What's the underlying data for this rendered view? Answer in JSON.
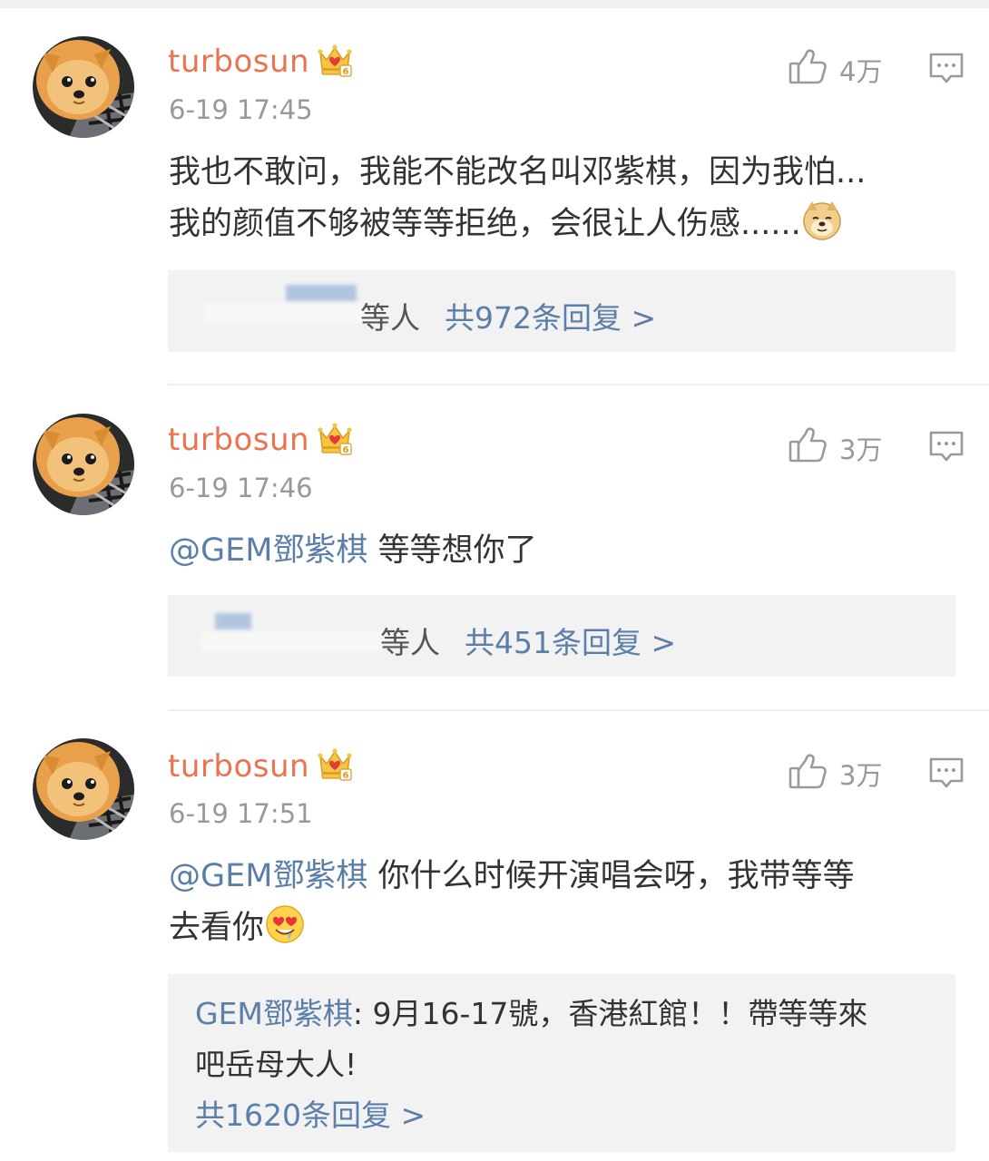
{
  "comments": [
    {
      "username": "turbosun",
      "time": "6-19 17:45",
      "likes": "4万",
      "text_line1": "我也不敢问，我能不能改名叫邓紫棋，因为我怕...",
      "text_line2": "我的颜值不够被等等拒绝，会很让人伤感......",
      "reply_suffix": "等人",
      "reply_total": "共972条回复 >"
    },
    {
      "username": "turbosun",
      "time": "6-19 17:46",
      "likes": "3万",
      "mention": "@GEM鄧紫棋",
      "text": " 等等想你了",
      "reply_suffix": "等人",
      "reply_total": "共451条回复 >"
    },
    {
      "username": "turbosun",
      "time": "6-19 17:51",
      "likes": "3万",
      "mention": "@GEM鄧紫棋",
      "text_line1": " 你什么时候开演唱会呀，我带等等",
      "text_line2": "去看你",
      "reply_name": "GEM鄧紫棋",
      "reply_text_line1": ": 9月16-17號，香港紅館！！帶等等來",
      "reply_text_line2": "吧岳母大人!",
      "reply_total": "共1620条回复 >"
    }
  ],
  "icons": {
    "avatar": "pomeranian-avatar-icon",
    "badge": "crown-badge-icon",
    "like": "thumbs-up-icon",
    "comment": "comment-bubble-icon",
    "emoji_doge": "doge-emoji-icon",
    "emoji_heart_eyes": "heart-eyes-emoji-icon"
  },
  "colors": {
    "username": "#eb7350",
    "link": "#5b7fa8",
    "meta": "#999999",
    "reply_bg": "#f2f2f2"
  }
}
